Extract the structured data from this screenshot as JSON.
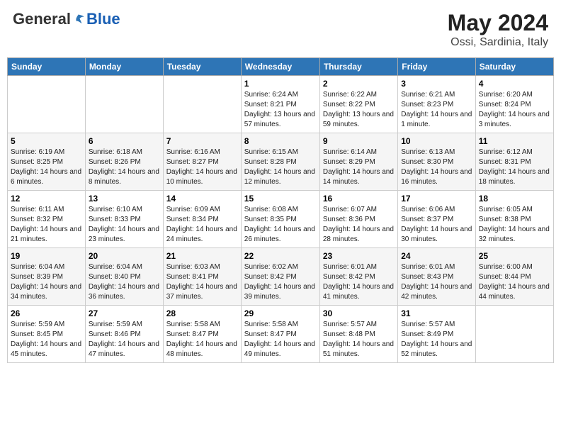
{
  "logo": {
    "general": "General",
    "blue": "Blue"
  },
  "header": {
    "month": "May 2024",
    "location": "Ossi, Sardinia, Italy"
  },
  "weekdays": [
    "Sunday",
    "Monday",
    "Tuesday",
    "Wednesday",
    "Thursday",
    "Friday",
    "Saturday"
  ],
  "weeks": [
    [
      {
        "day": "",
        "sunrise": "",
        "sunset": "",
        "daylight": ""
      },
      {
        "day": "",
        "sunrise": "",
        "sunset": "",
        "daylight": ""
      },
      {
        "day": "",
        "sunrise": "",
        "sunset": "",
        "daylight": ""
      },
      {
        "day": "1",
        "sunrise": "Sunrise: 6:24 AM",
        "sunset": "Sunset: 8:21 PM",
        "daylight": "Daylight: 13 hours and 57 minutes."
      },
      {
        "day": "2",
        "sunrise": "Sunrise: 6:22 AM",
        "sunset": "Sunset: 8:22 PM",
        "daylight": "Daylight: 13 hours and 59 minutes."
      },
      {
        "day": "3",
        "sunrise": "Sunrise: 6:21 AM",
        "sunset": "Sunset: 8:23 PM",
        "daylight": "Daylight: 14 hours and 1 minute."
      },
      {
        "day": "4",
        "sunrise": "Sunrise: 6:20 AM",
        "sunset": "Sunset: 8:24 PM",
        "daylight": "Daylight: 14 hours and 3 minutes."
      }
    ],
    [
      {
        "day": "5",
        "sunrise": "Sunrise: 6:19 AM",
        "sunset": "Sunset: 8:25 PM",
        "daylight": "Daylight: 14 hours and 6 minutes."
      },
      {
        "day": "6",
        "sunrise": "Sunrise: 6:18 AM",
        "sunset": "Sunset: 8:26 PM",
        "daylight": "Daylight: 14 hours and 8 minutes."
      },
      {
        "day": "7",
        "sunrise": "Sunrise: 6:16 AM",
        "sunset": "Sunset: 8:27 PM",
        "daylight": "Daylight: 14 hours and 10 minutes."
      },
      {
        "day": "8",
        "sunrise": "Sunrise: 6:15 AM",
        "sunset": "Sunset: 8:28 PM",
        "daylight": "Daylight: 14 hours and 12 minutes."
      },
      {
        "day": "9",
        "sunrise": "Sunrise: 6:14 AM",
        "sunset": "Sunset: 8:29 PM",
        "daylight": "Daylight: 14 hours and 14 minutes."
      },
      {
        "day": "10",
        "sunrise": "Sunrise: 6:13 AM",
        "sunset": "Sunset: 8:30 PM",
        "daylight": "Daylight: 14 hours and 16 minutes."
      },
      {
        "day": "11",
        "sunrise": "Sunrise: 6:12 AM",
        "sunset": "Sunset: 8:31 PM",
        "daylight": "Daylight: 14 hours and 18 minutes."
      }
    ],
    [
      {
        "day": "12",
        "sunrise": "Sunrise: 6:11 AM",
        "sunset": "Sunset: 8:32 PM",
        "daylight": "Daylight: 14 hours and 21 minutes."
      },
      {
        "day": "13",
        "sunrise": "Sunrise: 6:10 AM",
        "sunset": "Sunset: 8:33 PM",
        "daylight": "Daylight: 14 hours and 23 minutes."
      },
      {
        "day": "14",
        "sunrise": "Sunrise: 6:09 AM",
        "sunset": "Sunset: 8:34 PM",
        "daylight": "Daylight: 14 hours and 24 minutes."
      },
      {
        "day": "15",
        "sunrise": "Sunrise: 6:08 AM",
        "sunset": "Sunset: 8:35 PM",
        "daylight": "Daylight: 14 hours and 26 minutes."
      },
      {
        "day": "16",
        "sunrise": "Sunrise: 6:07 AM",
        "sunset": "Sunset: 8:36 PM",
        "daylight": "Daylight: 14 hours and 28 minutes."
      },
      {
        "day": "17",
        "sunrise": "Sunrise: 6:06 AM",
        "sunset": "Sunset: 8:37 PM",
        "daylight": "Daylight: 14 hours and 30 minutes."
      },
      {
        "day": "18",
        "sunrise": "Sunrise: 6:05 AM",
        "sunset": "Sunset: 8:38 PM",
        "daylight": "Daylight: 14 hours and 32 minutes."
      }
    ],
    [
      {
        "day": "19",
        "sunrise": "Sunrise: 6:04 AM",
        "sunset": "Sunset: 8:39 PM",
        "daylight": "Daylight: 14 hours and 34 minutes."
      },
      {
        "day": "20",
        "sunrise": "Sunrise: 6:04 AM",
        "sunset": "Sunset: 8:40 PM",
        "daylight": "Daylight: 14 hours and 36 minutes."
      },
      {
        "day": "21",
        "sunrise": "Sunrise: 6:03 AM",
        "sunset": "Sunset: 8:41 PM",
        "daylight": "Daylight: 14 hours and 37 minutes."
      },
      {
        "day": "22",
        "sunrise": "Sunrise: 6:02 AM",
        "sunset": "Sunset: 8:42 PM",
        "daylight": "Daylight: 14 hours and 39 minutes."
      },
      {
        "day": "23",
        "sunrise": "Sunrise: 6:01 AM",
        "sunset": "Sunset: 8:42 PM",
        "daylight": "Daylight: 14 hours and 41 minutes."
      },
      {
        "day": "24",
        "sunrise": "Sunrise: 6:01 AM",
        "sunset": "Sunset: 8:43 PM",
        "daylight": "Daylight: 14 hours and 42 minutes."
      },
      {
        "day": "25",
        "sunrise": "Sunrise: 6:00 AM",
        "sunset": "Sunset: 8:44 PM",
        "daylight": "Daylight: 14 hours and 44 minutes."
      }
    ],
    [
      {
        "day": "26",
        "sunrise": "Sunrise: 5:59 AM",
        "sunset": "Sunset: 8:45 PM",
        "daylight": "Daylight: 14 hours and 45 minutes."
      },
      {
        "day": "27",
        "sunrise": "Sunrise: 5:59 AM",
        "sunset": "Sunset: 8:46 PM",
        "daylight": "Daylight: 14 hours and 47 minutes."
      },
      {
        "day": "28",
        "sunrise": "Sunrise: 5:58 AM",
        "sunset": "Sunset: 8:47 PM",
        "daylight": "Daylight: 14 hours and 48 minutes."
      },
      {
        "day": "29",
        "sunrise": "Sunrise: 5:58 AM",
        "sunset": "Sunset: 8:47 PM",
        "daylight": "Daylight: 14 hours and 49 minutes."
      },
      {
        "day": "30",
        "sunrise": "Sunrise: 5:57 AM",
        "sunset": "Sunset: 8:48 PM",
        "daylight": "Daylight: 14 hours and 51 minutes."
      },
      {
        "day": "31",
        "sunrise": "Sunrise: 5:57 AM",
        "sunset": "Sunset: 8:49 PM",
        "daylight": "Daylight: 14 hours and 52 minutes."
      },
      {
        "day": "",
        "sunrise": "",
        "sunset": "",
        "daylight": ""
      }
    ]
  ]
}
